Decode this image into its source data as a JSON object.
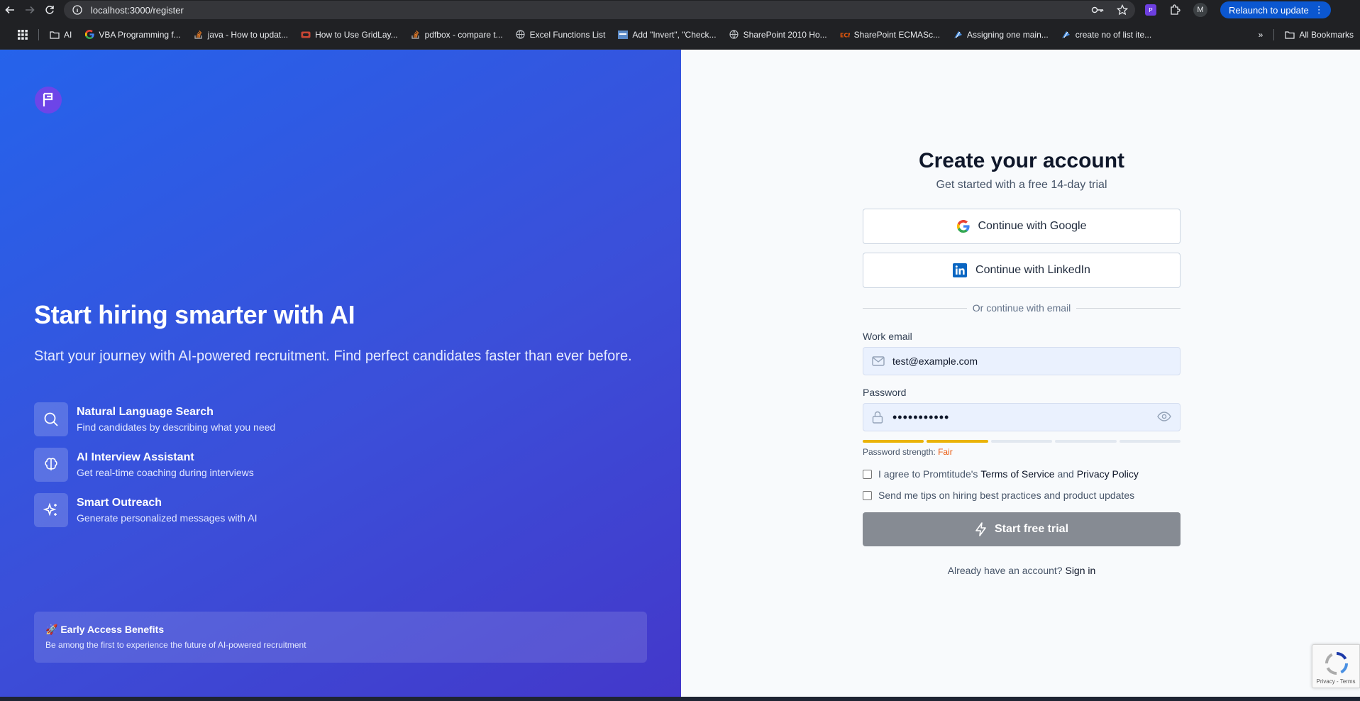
{
  "browser": {
    "url": "localhost:3000/register",
    "relaunch_label": "Relaunch to update",
    "profile_initial": "M",
    "ext_letter": "P",
    "bookmarks": [
      {
        "label": "AI",
        "icon": "folder-icon"
      },
      {
        "label": "VBA Programming f...",
        "icon": "google-icon"
      },
      {
        "label": "java - How to updat...",
        "icon": "stackoverflow-icon"
      },
      {
        "label": "How to Use GridLay...",
        "icon": "oracle-icon"
      },
      {
        "label": "pdfbox - compare t...",
        "icon": "stackoverflow-icon"
      },
      {
        "label": "Excel Functions List",
        "icon": "globe-icon"
      },
      {
        "label": "Add \"Invert\", \"Check...",
        "icon": "site-icon"
      },
      {
        "label": "SharePoint 2010 Ho...",
        "icon": "globe-icon"
      },
      {
        "label": "SharePoint ECMASc...",
        "icon": "site-icon"
      },
      {
        "label": "Assigning one main...",
        "icon": "site-icon"
      },
      {
        "label": "create no of list ite...",
        "icon": "site-icon"
      }
    ],
    "all_bookmarks_label": "All Bookmarks"
  },
  "hero": {
    "logo_letter": "P",
    "title": "Start hiring smarter with AI",
    "subtitle": "Start your journey with AI-powered recruitment. Find perfect candidates faster than ever before.",
    "features": [
      {
        "title": "Natural Language Search",
        "desc": "Find candidates by describing what you need",
        "icon": "search-icon"
      },
      {
        "title": "AI Interview Assistant",
        "desc": "Get real-time coaching during interviews",
        "icon": "brain-icon"
      },
      {
        "title": "Smart Outreach",
        "desc": "Generate personalized messages with AI",
        "icon": "sparkles-icon"
      }
    ],
    "benefit_title": "🚀 Early Access Benefits",
    "benefit_desc": "Be among the first to experience the future of AI-powered recruitment"
  },
  "form": {
    "title": "Create your account",
    "subtitle": "Get started with a free 14-day trial",
    "google_label": "Continue with Google",
    "linkedin_label": "Continue with LinkedIn",
    "divider_label": "Or continue with email",
    "email_label": "Work email",
    "email_value": "test@example.com",
    "password_label": "Password",
    "password_value": "•••••••••••",
    "strength_prefix": "Password strength:",
    "strength_value": "Fair",
    "strength_level": 2,
    "strength_total": 5,
    "agree_prefix": "I agree to Promtitude's",
    "terms_label": "Terms of Service",
    "and_label": "and",
    "privacy_label": "Privacy Policy",
    "tips_label": "Send me tips on hiring best practices and product updates",
    "submit_label": "Start free trial",
    "signin_prompt": "Already have an account?",
    "signin_label": "Sign in"
  },
  "recaptcha": {
    "terms": "Privacy - Terms"
  },
  "colors": {
    "hero_gradient_start": "#2563eb",
    "hero_gradient_end": "#4338ca",
    "strength_fill": "#eab308",
    "strength_fair_text": "#ea580c",
    "submit_disabled": "#868b93"
  }
}
